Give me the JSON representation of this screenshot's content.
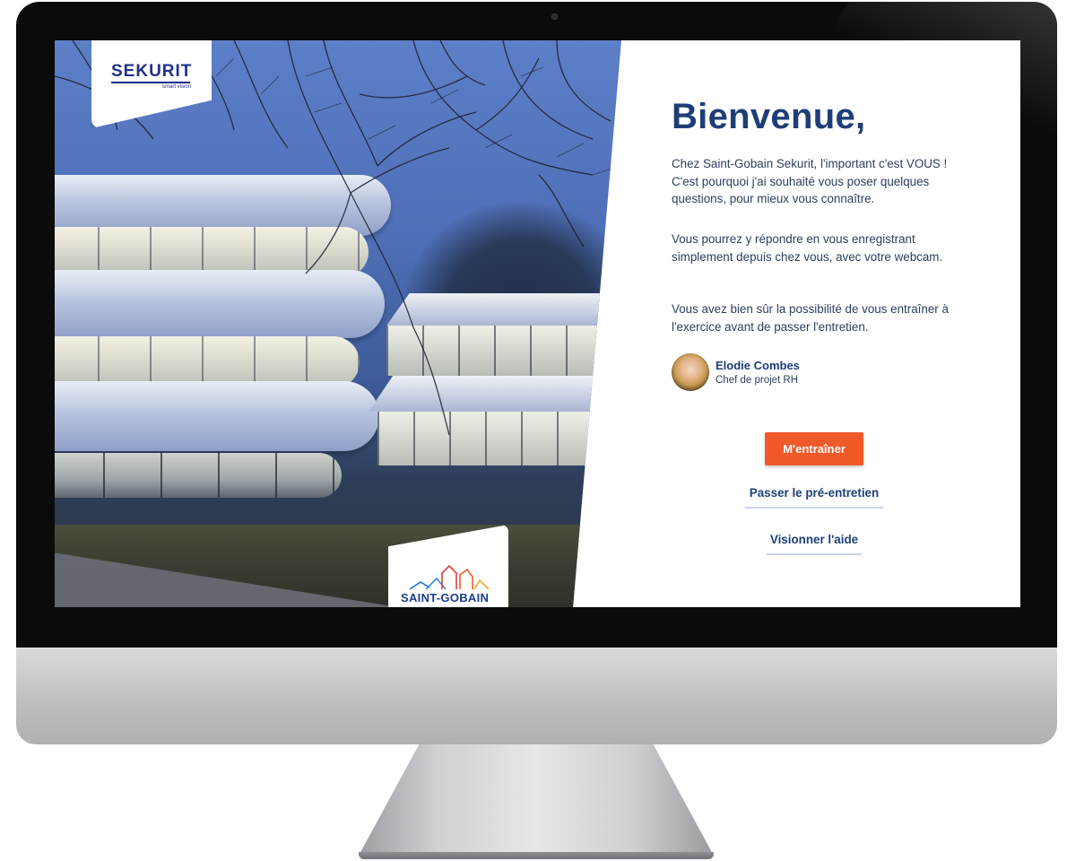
{
  "brand": {
    "sekurit_logo": "SEKURIT",
    "sekurit_tagline": "smart vision",
    "saint_gobain_logo": "SAINT-GOBAIN"
  },
  "welcome": {
    "title": "Bienvenue,",
    "paragraphs": [
      "Chez Saint-Gobain Sekurit, l'important c'est VOUS ! C'est pourquoi j'ai souhaité vous poser quelques questions, pour mieux vous connaître.",
      "Vous pourrez y répondre en vous enregistrant simplement depuis chez vous, avec votre webcam.",
      "Vous avez bien sûr la possibilité de vous entraîner à l'exercice avant de passer l'entretien."
    ]
  },
  "recruiter": {
    "name": "Elodie Combes",
    "role": "Chef de projet RH"
  },
  "actions": {
    "train_label": "M'entraîner",
    "pre_interview_label": "Passer le pré-entretien",
    "help_label": "Visionner l'aide"
  },
  "colors": {
    "title_blue": "#1f3e78",
    "accent_orange": "#f05a28",
    "link_underline": "#c8d4e6"
  },
  "icons": [
    "sekurit-logo",
    "saint-gobain-logo",
    "avatar-photo"
  ]
}
